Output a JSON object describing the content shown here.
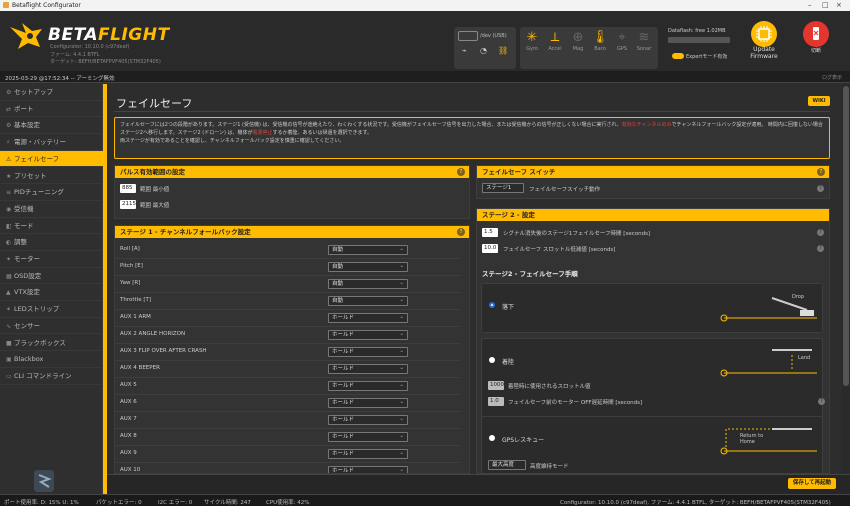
{
  "window": {
    "title": "Betaflight Configurator",
    "minimize": "–",
    "maximize": "□",
    "close": "×"
  },
  "header": {
    "brand_part1": "BETA",
    "brand_part2": "FLIGHT",
    "configurator_version": "Configurator: 10.10.0 (c97deaf)",
    "firmware": "ファーム: 4.4.1 BTFL",
    "target": "ターゲット: BEFH/BETAFPVF405(STM32F405)",
    "port": "/dev (USB)",
    "sensors": [
      {
        "label": "Gyro",
        "glyph": "✳",
        "on": true
      },
      {
        "label": "Accel",
        "glyph": "⟂",
        "on": true
      },
      {
        "label": "Mag",
        "glyph": "⊕",
        "on": false
      },
      {
        "label": "Baro",
        "glyph": "🌡",
        "on": true
      },
      {
        "label": "GPS",
        "glyph": "⌖",
        "on": false
      },
      {
        "label": "Sonar",
        "glyph": "≋",
        "on": false
      }
    ],
    "dataflash": "Dataflash: free 1.02MB",
    "expert_mode": "Expertモード有効",
    "update_firmware": "Update Firmware",
    "disconnect": "切断"
  },
  "log": {
    "timestamp": "2025-03-29 @17:52:34 -- アーミング無効",
    "show_log": "ログ表示"
  },
  "sidebar": {
    "items": [
      {
        "label": "セットアップ",
        "icon": "⚙"
      },
      {
        "label": "ポート",
        "icon": "⇄"
      },
      {
        "label": "基本設定",
        "icon": "⚙"
      },
      {
        "label": "電源・バッテリー",
        "icon": "⚡"
      },
      {
        "label": "フェイルセーフ",
        "icon": "⚠",
        "active": true
      },
      {
        "label": "プリセット",
        "icon": "★"
      },
      {
        "label": "PIDチューニング",
        "icon": "≡"
      },
      {
        "label": "受信機",
        "icon": "◉"
      },
      {
        "label": "モード",
        "icon": "◧"
      },
      {
        "label": "調整",
        "icon": "◐"
      },
      {
        "label": "モーター",
        "icon": "✦"
      },
      {
        "label": "OSD設定",
        "icon": "▦"
      },
      {
        "label": "VTX設定",
        "icon": "▲"
      },
      {
        "label": "LEDストリップ",
        "icon": "✶"
      },
      {
        "label": "センサー",
        "icon": "∿"
      },
      {
        "label": "ブラックボックス",
        "icon": "■"
      },
      {
        "label": "Blackbox",
        "icon": "▣"
      },
      {
        "label": "CLI コマンドライン",
        "icon": "▭"
      }
    ]
  },
  "page": {
    "title": "フェイルセーフ",
    "wiki": "WIKI",
    "notice_line1": "フェイルセーフには2つの段階があります。ステージ1 (受信機) は、受信機の信号が途絶えたり、わくわくする状況です。受信機がフェイルセーフ信号を出力した場合、または受信機からの信号が正しくない場合に実行され、",
    "notice_red": "有効なチャンネルのみ",
    "notice_line1b": "でチャンネルフォールバック設定が適用。",
    "notice_line2": "時間内に回復しない場合ステージ2へ移行します。ステージ2 (ドローン) は、機体が",
    "notice_red2": "電源停止",
    "notice_line2b": "するか着陸、あるいは帰還を選択できます。",
    "notice_line3": "両ステージが有効であることを確認し、チャンネルフォールバック設定を慎重に確認してください。"
  },
  "pulse": {
    "title": "パルス有効範囲の設定",
    "min_value": "885",
    "min_label": "範囲 最小値",
    "max_value": "2115",
    "max_label": "範囲 最大値"
  },
  "stage1": {
    "title": "ステージ 1 - チャンネルフォールバック設定",
    "rows": [
      {
        "label": "Roll [A]",
        "value": "自動"
      },
      {
        "label": "Pitch [E]",
        "value": "自動"
      },
      {
        "label": "Yaw [R]",
        "value": "自動"
      },
      {
        "label": "Throttle [T]",
        "value": "自動"
      },
      {
        "label": "AUX 1 ARM",
        "value": "ホールド"
      },
      {
        "label": "AUX 2 ANGLE HORIZON",
        "value": "ホールド"
      },
      {
        "label": "AUX 3 FLIP OVER AFTER CRASH",
        "value": "ホールド"
      },
      {
        "label": "AUX 4 BEEPER",
        "value": "ホールド"
      },
      {
        "label": "AUX 5",
        "value": "ホールド"
      },
      {
        "label": "AUX 6",
        "value": "ホールド"
      },
      {
        "label": "AUX 7",
        "value": "ホールド"
      },
      {
        "label": "AUX 8",
        "value": "ホールド"
      },
      {
        "label": "AUX 9",
        "value": "ホールド"
      },
      {
        "label": "AUX 10",
        "value": "ホールド"
      }
    ]
  },
  "switch": {
    "title": "フェイルセーフ スイッチ",
    "select": "ステージ1",
    "label": "フェイルセーフスイッチ動作"
  },
  "stage2": {
    "title": "ステージ 2 - 設定",
    "guard_value": "1.5",
    "guard_label": "シグナル消失後のステージ1フェイルセーフ時間 [seconds]",
    "throttle_value": "10.0",
    "throttle_label": "フェイルセーフ スロットル低減値 [seconds]",
    "procedure_title": "ステージ2 - フェイルセーフ手順",
    "drop_label": "落下",
    "drop_caption": "Drop",
    "land_label": "着陸",
    "land_caption": "Land",
    "land_throttle_value": "1000",
    "land_throttle_label": "着陸時に使用されるスロットル値",
    "land_delay_value": "1.0",
    "land_delay_label": "フェイルセーフ前のモーター OFF遅延時間 [seconds]",
    "gps_label": "GPSレスキュー",
    "gps_caption": "Return to Home",
    "gps_mode": "最大高度",
    "gps_mode_label": "高度維持モード"
  },
  "footer": {
    "save": "保存して再起動"
  },
  "status": {
    "port_util": "ポート使用率: D: 15% U: 1%",
    "packet_err": "パケットエラー: 0",
    "i2c_err": "I2C エラー: 0",
    "cycle": "サイクル時間: 247",
    "cpu": "CPU使用率: 42%",
    "version": "Configurator: 10.10.0 (c97deaf), ファーム: 4.4.1 BTFL, ターゲット: BEFH/BETAFPVF405(STM32F405)"
  }
}
